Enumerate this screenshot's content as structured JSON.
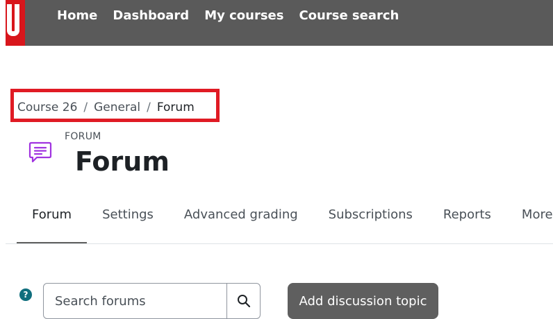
{
  "nav": {
    "items": [
      {
        "label": "Home"
      },
      {
        "label": "Dashboard"
      },
      {
        "label": "My courses"
      },
      {
        "label": "Course search"
      }
    ]
  },
  "breadcrumb": {
    "items": [
      {
        "label": "Course 26"
      },
      {
        "label": "General"
      },
      {
        "label": "Forum"
      }
    ],
    "separator": "/"
  },
  "header": {
    "kicker": "FORUM",
    "title": "Forum",
    "icon": "forum-icon"
  },
  "tabs": [
    {
      "label": "Forum",
      "active": true
    },
    {
      "label": "Settings"
    },
    {
      "label": "Advanced grading"
    },
    {
      "label": "Subscriptions"
    },
    {
      "label": "Reports"
    },
    {
      "label": "More"
    }
  ],
  "search": {
    "placeholder": "Search forums",
    "button_icon": "search-icon",
    "help_icon": "help-icon"
  },
  "actions": {
    "add_topic_label": "Add discussion topic"
  },
  "colors": {
    "topbar": "#5a5a5a",
    "brand": "#d8161c",
    "highlight_border": "#e01b24",
    "forum_icon": "#a033e0",
    "help_icon": "#0f6e7d",
    "button": "#5f5f5f"
  }
}
